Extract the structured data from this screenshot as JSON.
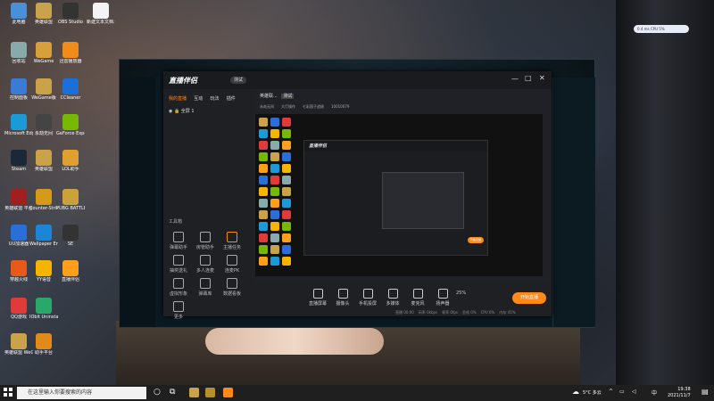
{
  "desktop_icons": [
    {
      "label": "此电脑",
      "color": "#4a90d9"
    },
    {
      "label": "英雄联盟",
      "color": "#c9a24a"
    },
    {
      "label": "OBS Studio",
      "color": "#333"
    },
    {
      "label": "新建文本文档.txt",
      "color": "#f4f4f4"
    },
    {
      "label": "回收站",
      "color": "#8aa"
    },
    {
      "label": "WeGame",
      "color": "#d8a03a"
    },
    {
      "label": "迅雷播放器",
      "color": "#f08c1a"
    },
    {
      "label": "控制面板",
      "color": "#3a7bd5"
    },
    {
      "label": "WeGame版",
      "color": "#c9a24a"
    },
    {
      "label": "CCleaner",
      "color": "#1a6fd9"
    },
    {
      "label": "Microsoft Edge",
      "color": "#1c9ad6"
    },
    {
      "label": "永劫无间",
      "color": "#444"
    },
    {
      "label": "GeForce Experience",
      "color": "#76b900"
    },
    {
      "label": "Steam",
      "color": "#1b2838"
    },
    {
      "label": "英雄联盟",
      "color": "#c9a24a"
    },
    {
      "label": "LOL助手",
      "color": "#e0a030"
    },
    {
      "label": "英雄联盟 平台",
      "color": "#a02020"
    },
    {
      "label": "Counter-Strike: Global Off...",
      "color": "#d69a1a"
    },
    {
      "label": "PUBG BATTLEGR...",
      "color": "#caa23a"
    },
    {
      "label": "UU加速器",
      "color": "#2a6fd9"
    },
    {
      "label": "Wallpaper Engine",
      "color": "#1b86d8"
    },
    {
      "label": "SE",
      "color": "#333"
    },
    {
      "label": "穿越火线",
      "color": "#e85a1a"
    },
    {
      "label": "YY语音",
      "color": "#f4b400"
    },
    {
      "label": "直播伴侣",
      "color": "#ff9f1a"
    },
    {
      "label": "QQ游戏",
      "color": "#e03a3a"
    },
    {
      "label": "IObit Uninstaller",
      "color": "#2aa86a"
    },
    {
      "label": "英雄联盟 WeGame版",
      "color": "#c9a24a"
    },
    {
      "label": "助手平台",
      "color": "#e08a1a"
    }
  ],
  "app": {
    "name": "直播伴侣",
    "badge": "测试",
    "tabs": [
      "我的直播",
      "互动",
      "玩法",
      "插件"
    ],
    "scene": "全屏 1",
    "tools_title": "工具箱",
    "tools": [
      "弹幕助手",
      "房管助手",
      "主播任务",
      "抽奖送礼",
      "多人连麦",
      "连麦PK",
      "虚拟形象",
      "弹幕库",
      "数据看板",
      "更多"
    ],
    "preview_title": "英雄联...",
    "preview_tag": "测试",
    "status_items": [
      "永劫无间",
      "大厅操作",
      "七彩国子战绩",
      "10010079"
    ],
    "bottom_tools": [
      "直播屏幕",
      "摄像头",
      "手机投屏",
      "多媒体",
      "麦克风",
      "扬声器"
    ],
    "start_label": "开始直播",
    "volume_label": "25%",
    "status_bar": [
      "直播 00:00",
      "码率 0kbps",
      "帧率 0fps",
      "丢帧 0%",
      "CPU 6%",
      "内存 45%"
    ]
  },
  "taskbar": {
    "search_placeholder": "在这里输入你要搜索的内容",
    "weather": "5°C 多云",
    "time": "19:38",
    "date": "2021/11/7",
    "ime": "中"
  },
  "perf_widget": "0.4 ms  CPU 5%"
}
